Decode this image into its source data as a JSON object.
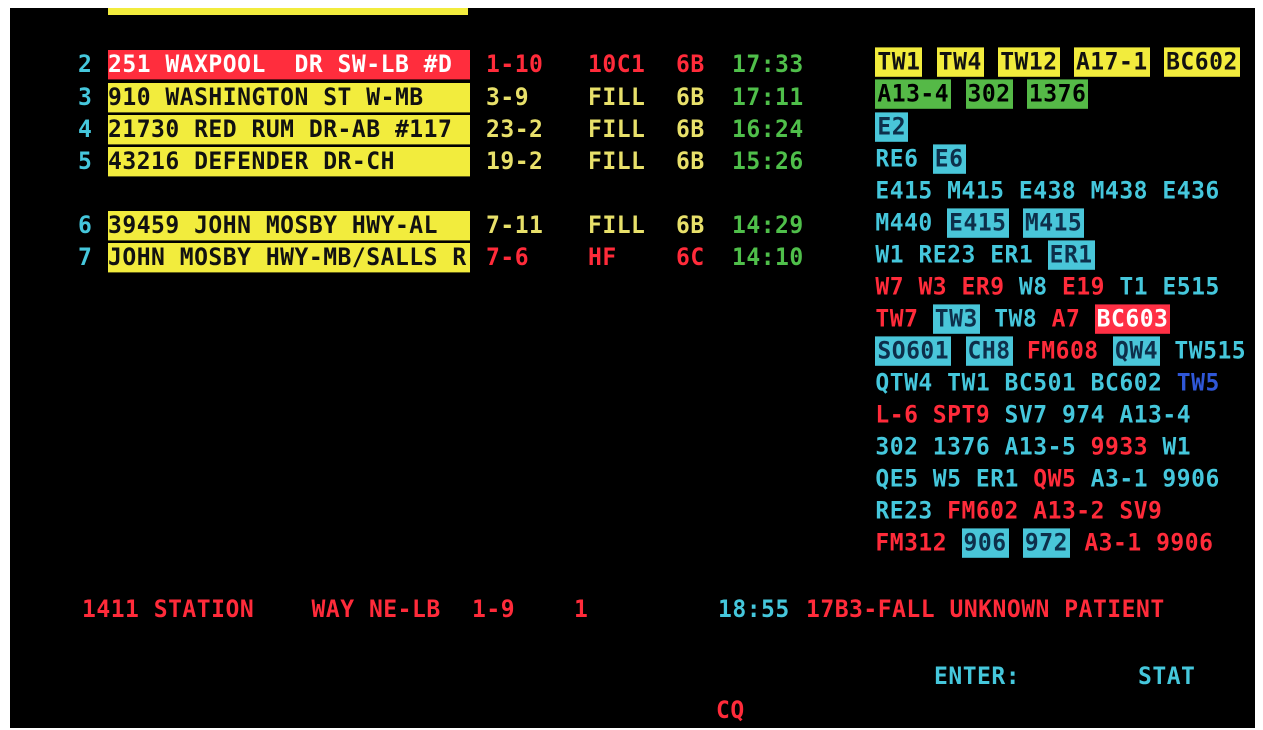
{
  "top_units": [
    "TW1",
    "TW4",
    "TW12",
    "A17-1",
    "BC602"
  ],
  "rows": [
    {
      "num": "2",
      "address": "251 WAXPOOL  DR SW-LB #D",
      "code": "1-10",
      "type": "10C1",
      "zone": "6B",
      "time": "17:33"
    },
    {
      "num": "3",
      "address": "910 WASHINGTON ST W-MB",
      "code": "3-9",
      "type": "FILL",
      "zone": "6B",
      "time": "17:11"
    },
    {
      "num": "4",
      "address": "21730 RED RUM DR-AB #117",
      "code": "23-2",
      "type": "FILL",
      "zone": "6B",
      "time": "16:24"
    },
    {
      "num": "5",
      "address": "43216 DEFENDER DR-CH",
      "code": "19-2",
      "type": "FILL",
      "zone": "6B",
      "time": "15:26"
    },
    {
      "num": "6",
      "address": "39459 JOHN MOSBY HWY-AL",
      "code": "7-11",
      "type": "FILL",
      "zone": "6B",
      "time": "14:29"
    },
    {
      "num": "7",
      "address": "JOHN MOSBY HWY-MB/SALLS R",
      "code": "7-6",
      "type": "HF",
      "zone": "6C",
      "time": "14:10"
    }
  ],
  "units": {
    "r2": [
      "A13-4",
      "302",
      "1376"
    ],
    "r3": [
      "E2"
    ],
    "r4": [
      "RE6",
      "E6"
    ],
    "r5a": [
      "E415",
      "M415",
      "E438",
      "M438",
      "E436"
    ],
    "r5b": [
      "M440",
      "E415",
      "M415"
    ],
    "r6": [
      "W1",
      "RE23",
      "ER1",
      "ER1"
    ],
    "r7a": [
      "W7",
      "W3",
      "ER9",
      "W8",
      "E19",
      "T1",
      "E515"
    ],
    "r7b": [
      "TW7",
      "TW3",
      "TW8",
      "A7",
      "BC603"
    ],
    "r7c": [
      "SO601",
      "CH8",
      "FM608",
      "QW4",
      "TW515"
    ],
    "r7d": [
      "QTW4",
      "TW1",
      "BC501",
      "BC602",
      "TW5"
    ],
    "r7e": [
      "L-6",
      "SPT9",
      "SV7",
      "974",
      "A13-4"
    ],
    "r7f": [
      "302",
      "1376",
      "A13-5",
      "9933",
      "W1"
    ],
    "r7g": [
      "QE5",
      "W5",
      "ER1",
      "QW5",
      "A3-1",
      "9906"
    ],
    "r7h": [
      "RE23",
      "FM602",
      "A13-2",
      "SV9"
    ],
    "r7i": [
      "FM312",
      "906",
      "972",
      "A3-1",
      "9906"
    ]
  },
  "pending": {
    "address": "1411 STATION    WAY NE-LB",
    "code": "1-9",
    "priority": "1",
    "time": "18:55",
    "nature": "17B3-FALL UNKNOWN PATIENT"
  },
  "footer": {
    "enter_label": "ENTER:",
    "stat_label": "STAT",
    "cq_label": "CQ"
  },
  "colors": {
    "background": "#000000",
    "cyan": "#45c7dc",
    "yellow_bg": "#f2ec3d",
    "red": "#ff2b3a",
    "green": "#4fbf4a",
    "blue": "#2f57d8"
  }
}
